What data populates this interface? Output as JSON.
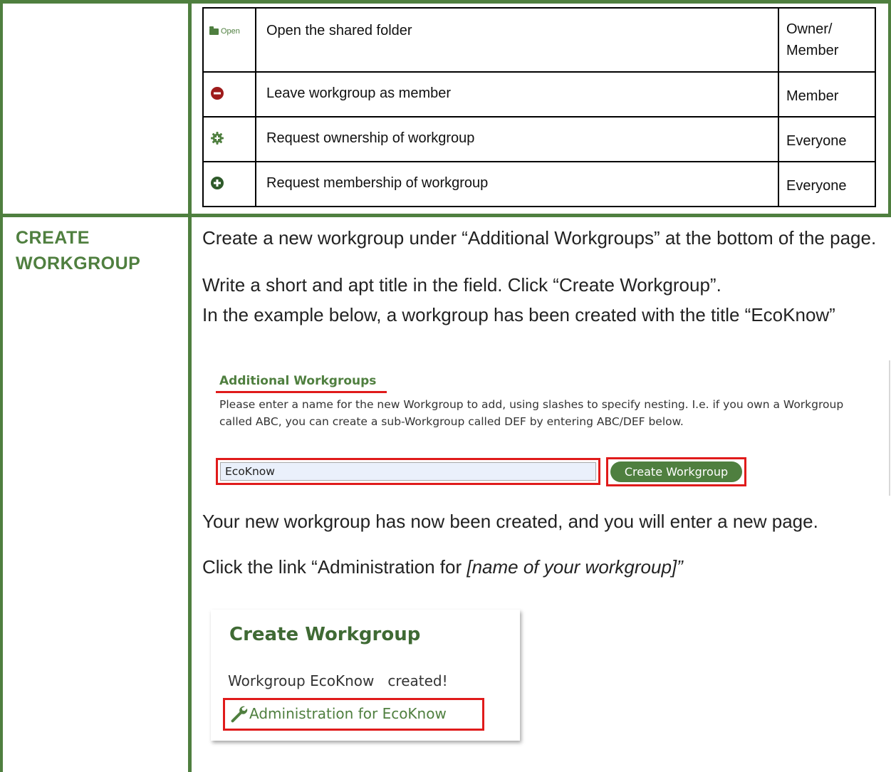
{
  "actions_table": {
    "rows": [
      {
        "icon": "open-folder-icon",
        "icon_label": "Open",
        "description": "Open the shared folder",
        "role": "Owner/ Member"
      },
      {
        "icon": "minus-circle-icon",
        "description": "Leave workgroup as member",
        "role": "Member"
      },
      {
        "icon": "gear-plus-icon",
        "description": "Request ownership of workgroup",
        "role": "Everyone"
      },
      {
        "icon": "plus-circle-icon",
        "description": "Request membership of workgroup",
        "role": "Everyone"
      }
    ]
  },
  "section": {
    "heading": "CREATE WORKGROUP",
    "p1": "Create a new workgroup under “Additional Workgroups” at the bottom of the page.",
    "p2": "Write a short and apt title in the field. Click “Create Workgroup”.",
    "p3": "In the example below, a workgroup has been created with the title “EcoKnow”",
    "p5": "Your new workgroup has now been created, and you will enter a new page.",
    "p6_prefix": "Click the link “Administration for ",
    "p6_italic": "[name of your workgroup]”"
  },
  "additional_workgroups": {
    "title": "Additional Workgroups",
    "description": "Please enter a name for the new Workgroup to add, using slashes to specify nesting. I.e. if you own a Workgroup called ABC, you can create a sub-Workgroup called DEF by entering ABC/DEF below.",
    "input_value": "EcoKnow",
    "button_label": "Create Workgroup"
  },
  "create_workgroup_result": {
    "title": "Create Workgroup",
    "message": "Workgroup EcoKnow   created!",
    "link_label": "Administration for EcoKnow"
  },
  "colors": {
    "brand_green": "#4f7f3f",
    "highlight_red": "#e01b1b",
    "leave_red": "#9e1b1b"
  }
}
